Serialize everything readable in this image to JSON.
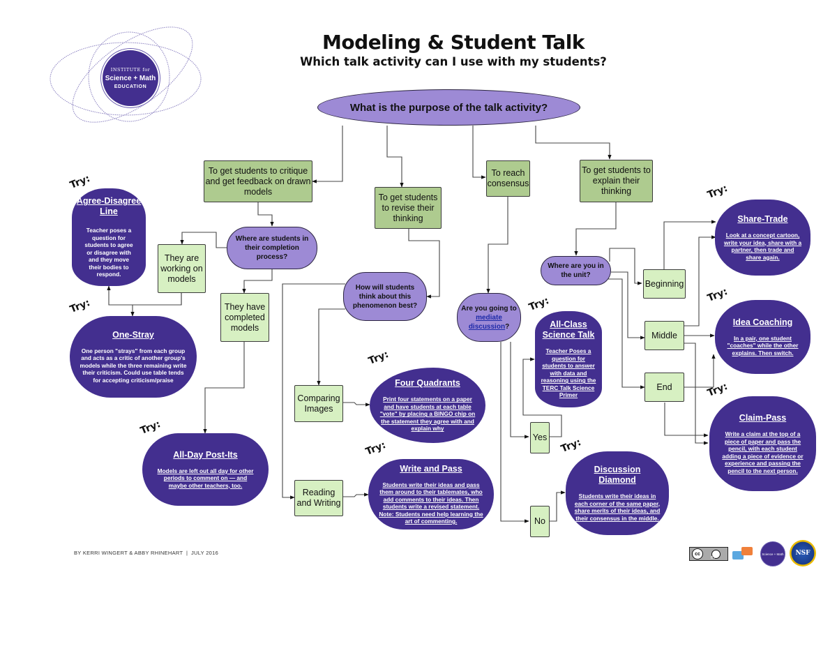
{
  "header": {
    "title": "Modeling & Student Talk",
    "subtitle": "Which talk activity can I use with my students?"
  },
  "logo": {
    "line1": "INSTITUTE for",
    "line2": "Science + Math",
    "line3": "EDUCATION"
  },
  "colors": {
    "question_fill": "#9d8ad5",
    "purpose_fill": "#aecb8f",
    "option_fill": "#d7f0c2",
    "activity_fill": "#432f8f",
    "link": "#1d2aa8"
  },
  "root_question": "What is the purpose of the talk activity?",
  "purposes": {
    "critique": "To get students to critique and get feedback on drawn models",
    "revise": "To get students to revise their thinking",
    "consensus": "To reach consensus",
    "explain": "To get students to explain their thinking"
  },
  "questions": {
    "completion": "Where are students in their completion process?",
    "phenomenon": "How will students think about this phenomenon best?",
    "mediate_prefix": "Are you going to",
    "mediate_link": "mediate discussion",
    "mediate_suffix": "?",
    "unit": "Where are you in the unit?"
  },
  "options": {
    "working": "They are working on models",
    "completed": "They have completed models",
    "comparing": "Comparing Images",
    "reading": "Reading and Writing",
    "yes": "Yes",
    "no": "No",
    "beginning": "Beginning",
    "middle": "Middle",
    "end": "End"
  },
  "try_label": "Try:",
  "activities": {
    "agree_disagree": {
      "title": "Agree-Disagree Line",
      "desc": "Teacher poses a question for students to agree or disagree with and they move their bodies to respond."
    },
    "one_stray": {
      "title": "One-Stray",
      "desc": "One person \"strays\" from each group and acts as a critic of another group's models while the three remaining write their criticism. Could use table tends for accepting criticism/praise"
    },
    "all_day": {
      "title": "All-Day Post-Its",
      "desc": "Models are left out all day for other periods to comment on — and maybe other teachers, too."
    },
    "four_quadrants": {
      "title": "Four Quadrants",
      "desc": "Print four statements on a paper and have students at each table \"vote\" by placing a BINGO chip on the statement they agree with and explain why"
    },
    "write_pass": {
      "title": "Write and Pass",
      "desc": "Students write their ideas and pass them around to their tablemates, who add comments to their ideas. Then students write a revised statement. Note: Students need help learning the art of commenting."
    },
    "all_class": {
      "title": "All-Class Science Talk",
      "desc": "Teacher Poses a question for students to answer with data and reasoning using the TERC Talk Science Primer"
    },
    "discussion_diamond": {
      "title": "Discussion Diamond",
      "desc": "Students write their ideas in each corner of the same paper, share merits of their ideas, and their consensus in the middle."
    },
    "share_trade": {
      "title": "Share-Trade",
      "desc": "Look at a concept cartoon, write your idea, share with a partner, then trade and share again."
    },
    "idea_coaching": {
      "title": "Idea Coaching",
      "desc": "In a pair, one student \"coaches\" while the other explains. Then switch."
    },
    "claim_pass": {
      "title": "Claim-Pass",
      "desc": "Write a claim at the top of a piece of paper and pass the pencil, with each student adding a piece of evidence or experience and passing the pencil to the next person."
    }
  },
  "footer": {
    "credit": "BY KERRI WINGERT & ABBY RHINEHART  |  JULY 2016",
    "badges": [
      "cc-by-license-badge",
      "chat-bubbles-logo",
      "institute-logo-small",
      "nsf-logo"
    ],
    "cc_label": "BY",
    "small_logo_text": "Science + Math",
    "nsf_text": "NSF"
  }
}
